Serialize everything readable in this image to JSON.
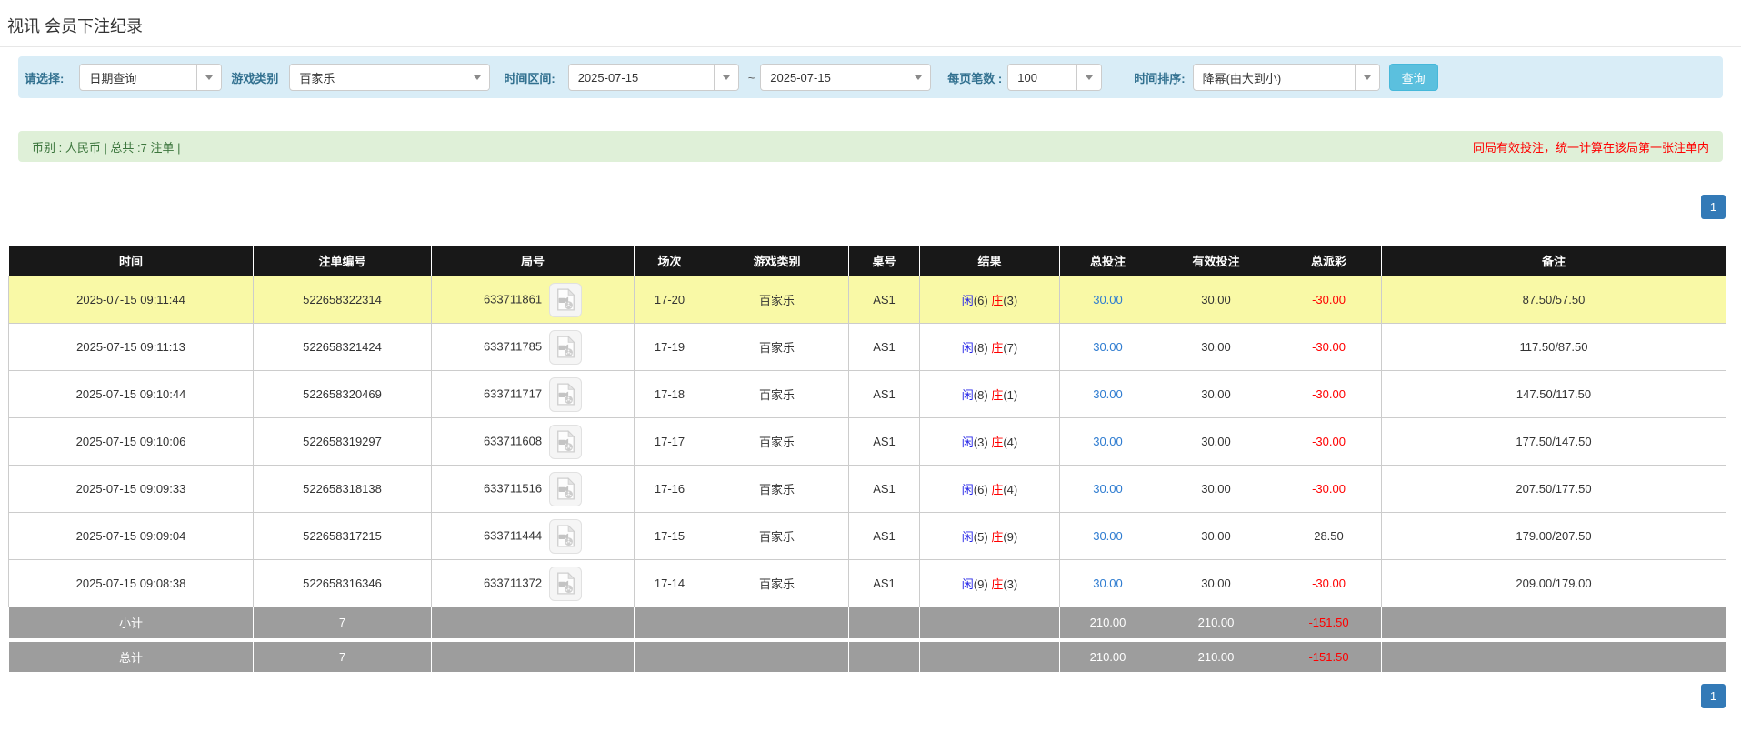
{
  "page_title": "视讯 会员下注纪录",
  "filters": {
    "select_label": "请选择:",
    "select_value": "日期查询",
    "game_label": "游戏类别",
    "game_value": "百家乐",
    "range_label": "时间区间:",
    "date_from": "2025-07-15",
    "range_separator": "~",
    "date_to": "2025-07-15",
    "per_page_label": "每页笔数 :",
    "per_page_value": "100",
    "sort_label": "时间排序:",
    "sort_value": "降幂(由大到小)",
    "search_button": "查询"
  },
  "summary_bar": {
    "left_text": "币别 : 人民币 | 总共 :7 注单 |",
    "right_text": "同局有效投注，统一计算在该局第一张注单内"
  },
  "pagination": {
    "page": "1"
  },
  "table": {
    "headers": [
      "时间",
      "注单编号",
      "局号",
      "场次",
      "游戏类别",
      "桌号",
      "结果",
      "总投注",
      "有效投注",
      "总派彩",
      "备注"
    ],
    "rows": [
      {
        "time": "2025-07-15 09:11:44",
        "bet_id": "522658322314",
        "round_id": "633711861",
        "session": "17-20",
        "game": "百家乐",
        "table_no": "AS1",
        "player": "闲",
        "player_score": "(6)",
        "banker": "庄",
        "banker_score": "(3)",
        "total_bet": "30.00",
        "valid_bet": "30.00",
        "payout": "-30.00",
        "remark": "87.50/57.50",
        "highlighted": true
      },
      {
        "time": "2025-07-15 09:11:13",
        "bet_id": "522658321424",
        "round_id": "633711785",
        "session": "17-19",
        "game": "百家乐",
        "table_no": "AS1",
        "player": "闲",
        "player_score": "(8)",
        "banker": "庄",
        "banker_score": "(7)",
        "total_bet": "30.00",
        "valid_bet": "30.00",
        "payout": "-30.00",
        "remark": "117.50/87.50",
        "highlighted": false
      },
      {
        "time": "2025-07-15 09:10:44",
        "bet_id": "522658320469",
        "round_id": "633711717",
        "session": "17-18",
        "game": "百家乐",
        "table_no": "AS1",
        "player": "闲",
        "player_score": "(8)",
        "banker": "庄",
        "banker_score": "(1)",
        "total_bet": "30.00",
        "valid_bet": "30.00",
        "payout": "-30.00",
        "remark": "147.50/117.50",
        "highlighted": false
      },
      {
        "time": "2025-07-15 09:10:06",
        "bet_id": "522658319297",
        "round_id": "633711608",
        "session": "17-17",
        "game": "百家乐",
        "table_no": "AS1",
        "player": "闲",
        "player_score": "(3)",
        "banker": "庄",
        "banker_score": "(4)",
        "total_bet": "30.00",
        "valid_bet": "30.00",
        "payout": "-30.00",
        "remark": "177.50/147.50",
        "highlighted": false
      },
      {
        "time": "2025-07-15 09:09:33",
        "bet_id": "522658318138",
        "round_id": "633711516",
        "session": "17-16",
        "game": "百家乐",
        "table_no": "AS1",
        "player": "闲",
        "player_score": "(6)",
        "banker": "庄",
        "banker_score": "(4)",
        "total_bet": "30.00",
        "valid_bet": "30.00",
        "payout": "-30.00",
        "remark": "207.50/177.50",
        "highlighted": false
      },
      {
        "time": "2025-07-15 09:09:04",
        "bet_id": "522658317215",
        "round_id": "633711444",
        "session": "17-15",
        "game": "百家乐",
        "table_no": "AS1",
        "player": "闲",
        "player_score": "(5)",
        "banker": "庄",
        "banker_score": "(9)",
        "total_bet": "30.00",
        "valid_bet": "30.00",
        "payout": "28.50",
        "remark": "179.00/207.50",
        "highlighted": false
      },
      {
        "time": "2025-07-15 09:08:38",
        "bet_id": "522658316346",
        "round_id": "633711372",
        "session": "17-14",
        "game": "百家乐",
        "table_no": "AS1",
        "player": "闲",
        "player_score": "(9)",
        "banker": "庄",
        "banker_score": "(3)",
        "total_bet": "30.00",
        "valid_bet": "30.00",
        "payout": "-30.00",
        "remark": "209.00/179.00",
        "highlighted": false
      }
    ],
    "subtotal": {
      "label": "小计",
      "count": "7",
      "total_bet": "210.00",
      "valid_bet": "210.00",
      "payout": "-151.50"
    },
    "grand_total": {
      "label": "总计",
      "count": "7",
      "total_bet": "210.00",
      "valid_bet": "210.00",
      "payout": "-151.50"
    }
  },
  "colors": {
    "accent_blue": "#337ab7",
    "info_bg": "#d9edf7",
    "info_label": "#31708f",
    "search_btn": "#5bc0de",
    "success_bg": "#dff0d8",
    "success_text": "#3c763d",
    "alert_red": "#ff0000",
    "header_bg": "#181818",
    "row_highlight": "#f9f9a6",
    "summary_bg": "#9d9d9d",
    "border_grey": "#cccccc",
    "link_blue": "#2d7bd0",
    "player_blue": "#2929e8",
    "banker_red": "#ff0000",
    "negative_red": "#ff0000"
  }
}
